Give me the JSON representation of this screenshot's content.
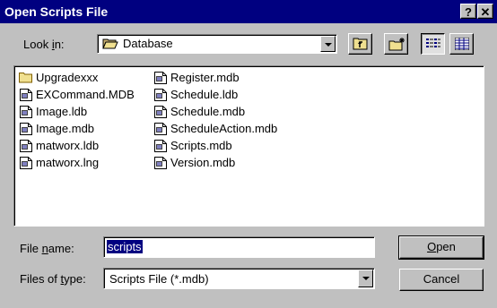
{
  "window": {
    "title": "Open Scripts File",
    "help_label": "?",
    "close_label": "✕"
  },
  "look_in": {
    "label_pre": "Look ",
    "label_mnemonic": "i",
    "label_post": "n:",
    "value": "Database",
    "icon": "folder-open-icon"
  },
  "toolbar": {
    "up_icon": "up-one-level-icon",
    "new_folder_icon": "new-folder-icon",
    "list_view_icon": "list-view-icon",
    "details_view_icon": "details-view-icon"
  },
  "files": {
    "column1": [
      {
        "name": "Upgradexxx",
        "icon": "folder-icon"
      },
      {
        "name": "EXCommand.MDB",
        "icon": "database-file-icon"
      },
      {
        "name": "Image.ldb",
        "icon": "database-file-icon"
      },
      {
        "name": "Image.mdb",
        "icon": "database-file-icon"
      },
      {
        "name": "matworx.ldb",
        "icon": "database-file-icon"
      },
      {
        "name": "matworx.lng",
        "icon": "database-file-icon"
      }
    ],
    "column2": [
      {
        "name": "Register.mdb",
        "icon": "database-file-icon"
      },
      {
        "name": "Schedule.ldb",
        "icon": "database-file-icon"
      },
      {
        "name": "Schedule.mdb",
        "icon": "database-file-icon"
      },
      {
        "name": "ScheduleAction.mdb",
        "icon": "database-file-icon"
      },
      {
        "name": "Scripts.mdb",
        "icon": "database-file-icon"
      },
      {
        "name": "Version.mdb",
        "icon": "database-file-icon"
      }
    ]
  },
  "file_name": {
    "label_pre": "File ",
    "label_mnemonic": "n",
    "label_post": "ame:",
    "value": "scripts"
  },
  "file_type": {
    "label_pre": "Files of ",
    "label_mnemonic": "t",
    "label_post": "ype:",
    "value": "Scripts File (*.mdb)"
  },
  "buttons": {
    "open_mnemonic": "O",
    "open_rest": "pen",
    "cancel": "Cancel"
  },
  "colors": {
    "titlebar": "#000080",
    "face": "#c0c0c0",
    "selection": "#000080"
  }
}
